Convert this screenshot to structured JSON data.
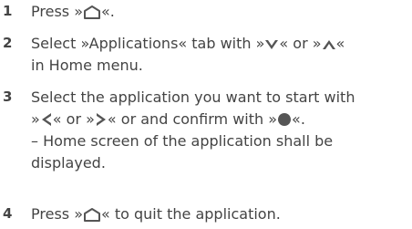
{
  "steps": [
    {
      "number": "1",
      "text": {
        "before": "Press »",
        "icon": "home-icon",
        "after": "«."
      }
    },
    {
      "number": "2",
      "text": {
        "line1_a": "Select »Applications« tab with »",
        "icon1": "arrow-down-icon",
        "line1_b": "« or »",
        "icon2": "arrow-up-icon",
        "line1_c": "«",
        "line2": "in Home menu."
      }
    },
    {
      "number": "3",
      "text": {
        "line1": "Select the application you want to start with",
        "line2_a": "»",
        "icon1": "arrow-left-icon",
        "line2_b": "« or »",
        "icon2": "arrow-right-icon",
        "line2_c": "« or and confirm with »",
        "icon3": "ok-button-icon",
        "line2_d": "«.",
        "line3": "– Home screen of the application shall be",
        "line4": "displayed."
      }
    },
    {
      "number": "4",
      "text": {
        "before": "Press »",
        "icon": "home-icon",
        "after": "« to quit the application."
      }
    }
  ],
  "colors": {
    "text": "#444444",
    "number": "#555555",
    "icon": "#555555"
  }
}
